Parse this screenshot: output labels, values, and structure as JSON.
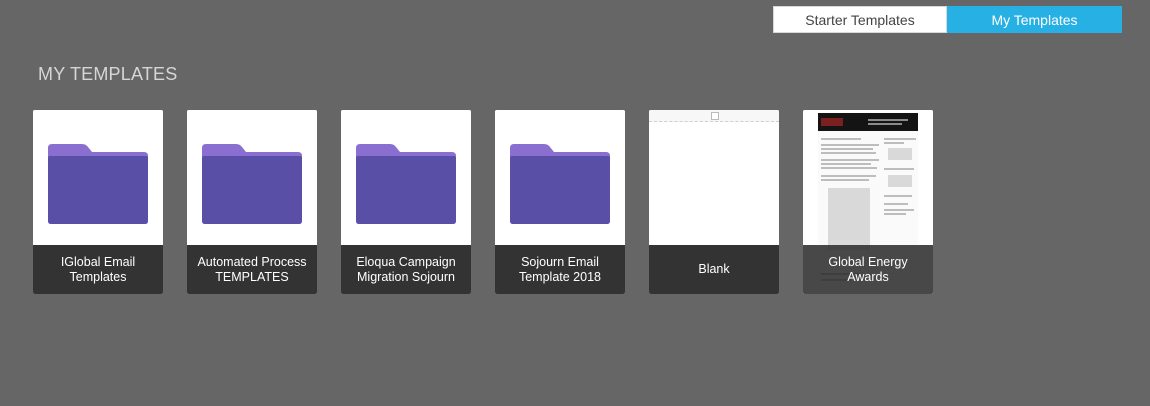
{
  "tabs": {
    "starter_label": "Starter Templates",
    "mine_label": "My Templates",
    "active": "mine"
  },
  "section": {
    "title": "MY TEMPLATES"
  },
  "cards": [
    {
      "label": "IGlobal Email Templates",
      "kind": "folder"
    },
    {
      "label": "Automated Process TEMPLATES",
      "kind": "folder"
    },
    {
      "label": "Eloqua Campaign Migration Sojourn",
      "kind": "folder"
    },
    {
      "label": "Sojourn Email Template 2018",
      "kind": "folder"
    },
    {
      "label": "Blank",
      "kind": "blank"
    },
    {
      "label": "Global Energy Awards",
      "kind": "email-preview"
    }
  ],
  "colors": {
    "background": "#666666",
    "active_tab": "#27b0e4",
    "folder_back": "#8a6fd0",
    "folder_front": "#5a4fa6"
  }
}
